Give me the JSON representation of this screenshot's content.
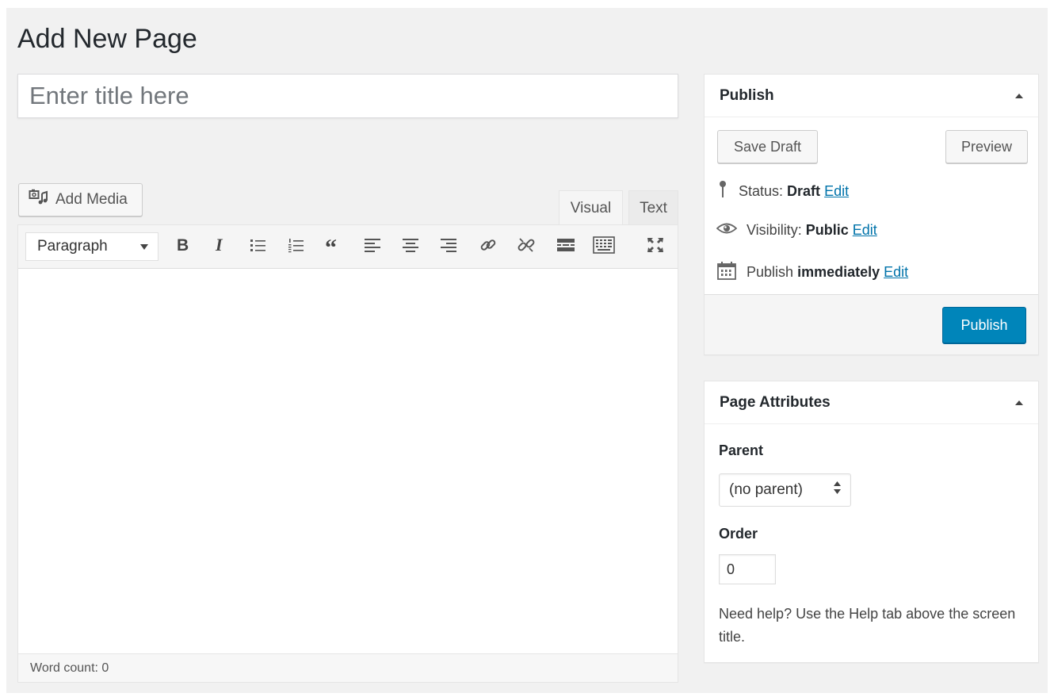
{
  "page": {
    "title": "Add New Page"
  },
  "title_field": {
    "placeholder": "Enter title here",
    "value": ""
  },
  "editor": {
    "add_media_label": "Add Media",
    "tabs": [
      {
        "label": "Visual",
        "active": true
      },
      {
        "label": "Text",
        "active": false
      }
    ],
    "format_select": "Paragraph",
    "toolbar_icons": [
      "bold-icon",
      "italic-icon",
      "bulleted-list-icon",
      "numbered-list-icon",
      "blockquote-icon",
      "align-left-icon",
      "align-center-icon",
      "align-right-icon",
      "insert-link-icon",
      "remove-link-icon",
      "read-more-icon",
      "toolbar-toggle-icon",
      "fullscreen-icon"
    ],
    "word_count": "Word count: 0"
  },
  "publish_box": {
    "title": "Publish",
    "save_draft": "Save Draft",
    "preview": "Preview",
    "status_label": "Status:",
    "status_value": "Draft",
    "visibility_label": "Visibility:",
    "visibility_value": "Public",
    "schedule_label": "Publish",
    "schedule_value": "immediately",
    "edit_label": "Edit",
    "publish_button": "Publish"
  },
  "attributes_box": {
    "title": "Page Attributes",
    "parent_label": "Parent",
    "parent_value": "(no parent)",
    "order_label": "Order",
    "order_value": "0",
    "help_text": "Need help? Use the Help tab above the screen title."
  },
  "colors": {
    "primary_button": "#0085ba",
    "link": "#0073aa",
    "background": "#f1f1f1"
  }
}
